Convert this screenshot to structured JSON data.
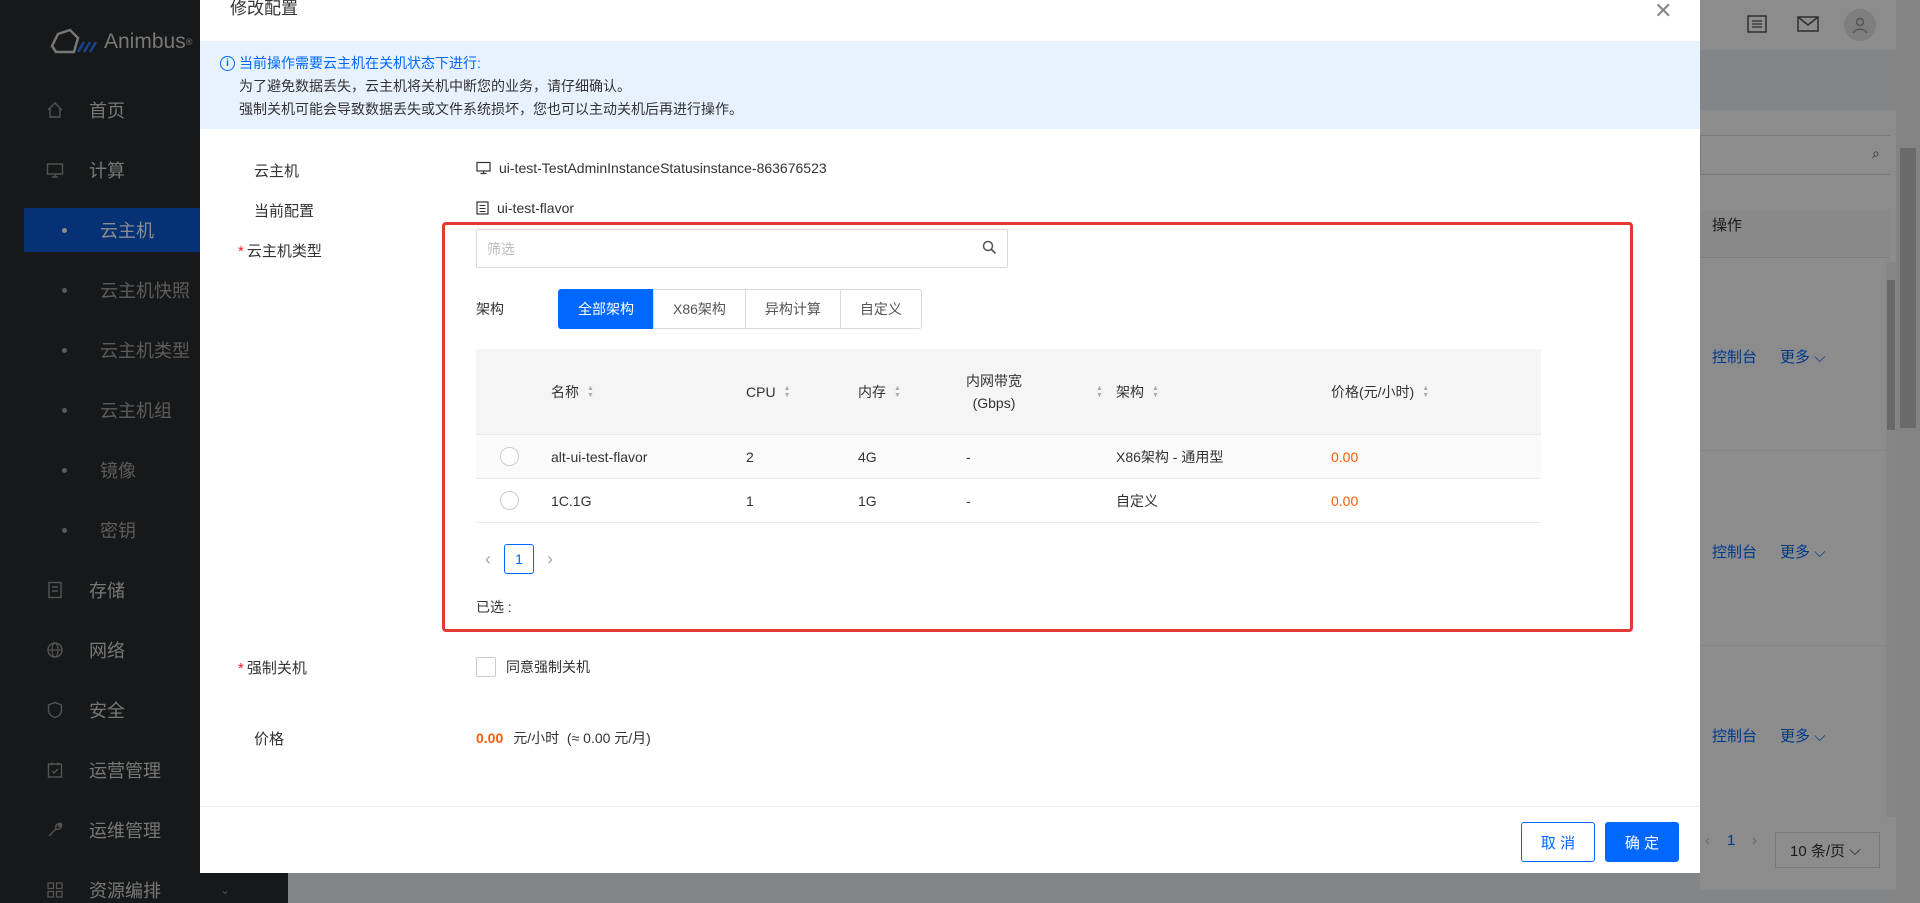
{
  "sidebar": {
    "brand": "Animbus",
    "brand_mark": "®",
    "items": [
      {
        "label": "首页",
        "icon": "home-icon"
      },
      {
        "label": "计算",
        "icon": "monitor-icon"
      },
      {
        "label": "云主机",
        "sub": true,
        "active": true
      },
      {
        "label": "云主机快照",
        "sub": true
      },
      {
        "label": "云主机类型",
        "sub": true
      },
      {
        "label": "云主机组",
        "sub": true
      },
      {
        "label": "镜像",
        "sub": true
      },
      {
        "label": "密钥",
        "sub": true
      },
      {
        "label": "存储",
        "icon": "storage-icon"
      },
      {
        "label": "网络",
        "icon": "globe-icon"
      },
      {
        "label": "安全",
        "icon": "shield-icon"
      },
      {
        "label": "运营管理",
        "icon": "calendar-icon"
      },
      {
        "label": "运维管理",
        "icon": "wrench-icon"
      },
      {
        "label": "资源编排",
        "icon": "grid-icon"
      }
    ]
  },
  "background": {
    "column_header": "操作",
    "row_actions": [
      {
        "console": "控制台",
        "more": "更多"
      },
      {
        "console": "控制台",
        "more": "更多"
      },
      {
        "console": "控制台",
        "more": "更多"
      }
    ],
    "pager": {
      "page": "1",
      "page_size": "10 条/页"
    }
  },
  "modal": {
    "title": "修改配置",
    "alert": {
      "line1": "当前操作需要云主机在关机状态下进行:",
      "line2": "为了避免数据丢失，云主机将关机中断您的业务，请仔细确认。",
      "line3": "强制关机可能会导致数据丢失或文件系统损坏，您也可以主动关机后再进行操作。"
    },
    "fields": {
      "instance_label": "云主机",
      "instance_value": "ui-test-TestAdminInstanceStatusinstance-863676523",
      "current_flavor_label": "当前配置",
      "current_flavor_value": "ui-test-flavor",
      "flavor_type_label": "云主机类型",
      "force_shutdown_label": "强制关机",
      "force_shutdown_checkbox": "同意强制关机",
      "price_label": "价格",
      "price_value": "0.00",
      "price_unit": "元/小时",
      "price_monthly": "(≈ 0.00 元/月)"
    },
    "search": {
      "placeholder": "筛选"
    },
    "arch": {
      "label": "架构",
      "tabs": [
        "全部架构",
        "X86架构",
        "异构计算",
        "自定义"
      ],
      "active": "全部架构"
    },
    "table": {
      "columns": [
        "名称",
        "CPU",
        "内存",
        "内网带宽",
        "(Gbps)",
        "架构",
        "价格(元/小时)"
      ],
      "rows": [
        {
          "name": "alt-ui-test-flavor",
          "cpu": "2",
          "memory": "4G",
          "bandwidth": "-",
          "arch": "X86架构 - 通用型",
          "price": "0.00"
        },
        {
          "name": "1C.1G",
          "cpu": "1",
          "memory": "1G",
          "bandwidth": "-",
          "arch": "自定义",
          "price": "0.00"
        }
      ]
    },
    "pagination": {
      "current": "1"
    },
    "selected_label": "已选 :",
    "footer": {
      "cancel": "取 消",
      "ok": "确 定"
    }
  },
  "colors": {
    "accent": "#0068ff",
    "price": "#ff5a00",
    "highlight_box": "#e53935",
    "sidebar_bg": "#2b2c2e",
    "sidebar_active": "#0c5cd6"
  }
}
